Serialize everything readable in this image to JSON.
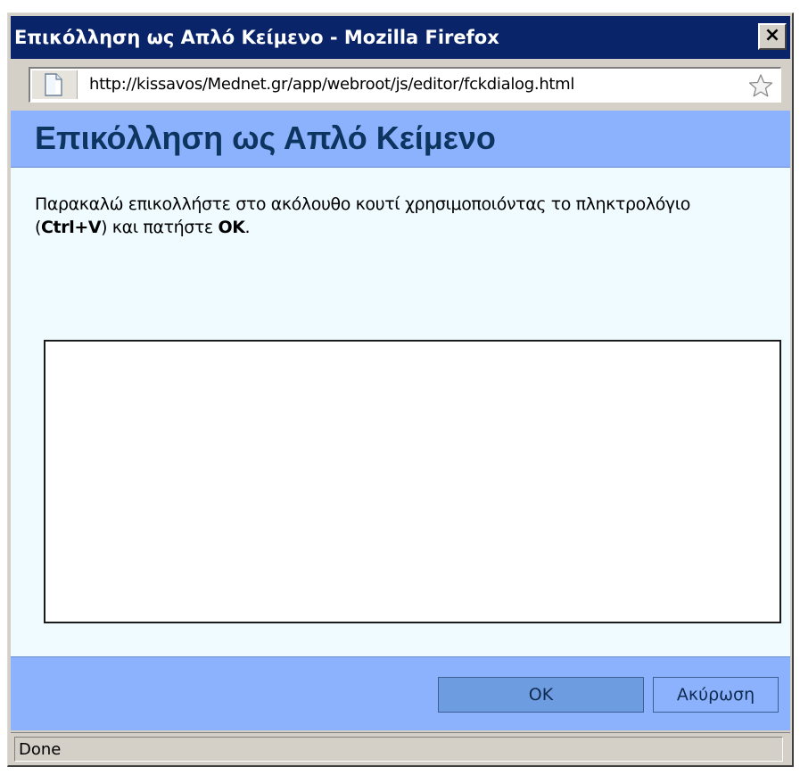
{
  "window": {
    "title": "Επικόλληση ως Απλό Κείμενο - Mozilla Firefox",
    "close_label": "×"
  },
  "urlbar": {
    "url": "http://kissavos/Mednet.gr/app/webroot/js/editor/fckdialog.html",
    "page_icon": "page-icon",
    "bookmark_icon": "star-icon"
  },
  "dialog": {
    "title": "Επικόλληση ως Απλό Κείμενο",
    "instructions": {
      "part1": "Παρακαλώ επικολλήστε στο ακόλουθο κουτί χρησιμοποιόντας το πληκτρολόγιο (",
      "shortcut": "Ctrl+V",
      "part2": ") και πατήστε ",
      "ok_word": "OK",
      "part3": "."
    },
    "paste_area_value": "",
    "ok_label": "OK",
    "cancel_label": "Ακύρωση"
  },
  "status": {
    "text": "Done"
  },
  "colors": {
    "titlebar": "#0a246a",
    "dialog_header": "#8cb2fd",
    "dialog_title": "#0e3460",
    "content_bg": "#f0fbff",
    "chrome": "#d4d0c8"
  }
}
